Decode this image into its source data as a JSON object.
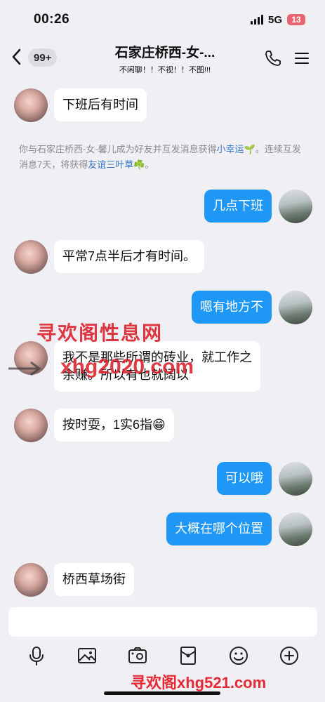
{
  "status_bar": {
    "time": "00:26",
    "network": "5G",
    "battery": "13"
  },
  "header": {
    "unread_count": "99+",
    "title": "石家庄桥西-女-...",
    "subtitle": "不闲聊！！不视！！不图!!!"
  },
  "messages": [
    {
      "side": "left",
      "text": "下班后有时间"
    },
    {
      "side": "right",
      "text": "几点下班"
    },
    {
      "side": "left",
      "text": "平常7点半后才有时间。"
    },
    {
      "side": "right",
      "text": "嗯有地方不"
    },
    {
      "side": "left",
      "line1": "我不是那些所谓的砖业，就工作之",
      "line2": "余赚。所以有也就阔以"
    },
    {
      "side": "left",
      "text": "按时耍，1实6指😁"
    },
    {
      "side": "right",
      "text": "可以哦"
    },
    {
      "side": "right",
      "text": "大概在哪个位置"
    },
    {
      "side": "left",
      "text": "桥西草场街"
    }
  ],
  "system_message": {
    "part1": "你与石家庄桥西-女-馨儿成为好友并互发消息获得",
    "link1": "小幸运🌱",
    "part2": "。连续互发消息7天，将获得",
    "link2": "友谊三叶草☘️",
    "part3": "。"
  },
  "watermarks": {
    "line1": "寻欢阁性息网",
    "line2": "xhg2020.com",
    "line3": "寻欢阁xhg521.com"
  },
  "colors": {
    "accent_blue": "#1e97f6",
    "background": "#efeff4",
    "battery_red": "#e8656f",
    "link": "#3474c4"
  },
  "icons": [
    "back-icon",
    "phone-icon",
    "menu-icon",
    "microphone-icon",
    "image-icon",
    "camera-icon",
    "red-packet-icon",
    "emoji-icon",
    "plus-icon"
  ]
}
